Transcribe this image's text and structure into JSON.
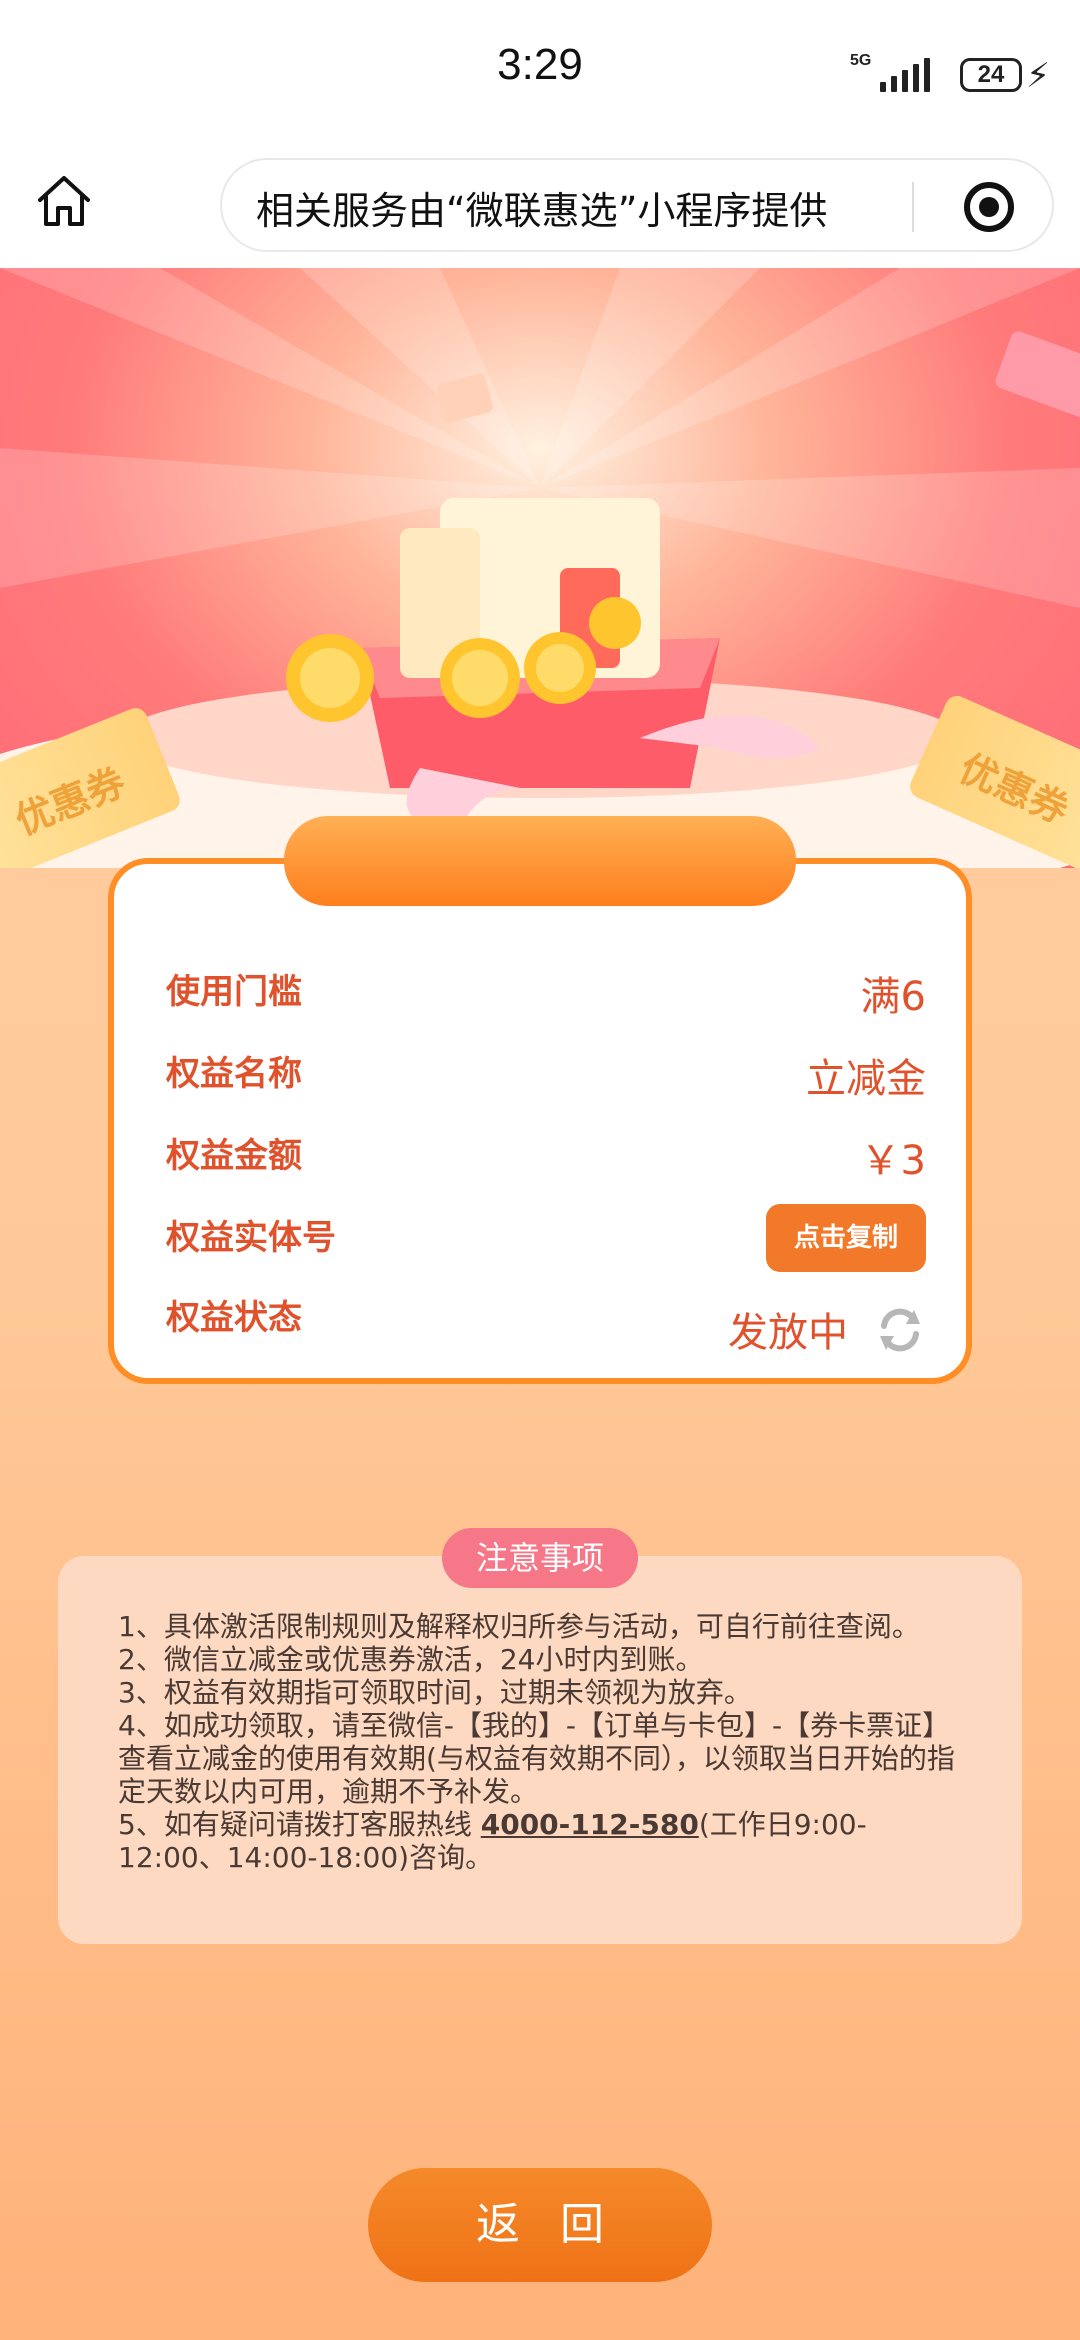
{
  "status_bar": {
    "time": "3:29",
    "network": "5G",
    "battery": "24"
  },
  "nav": {
    "service_text": "相关服务由“微联惠选”小程序提供"
  },
  "banner": {
    "left_ticket": "优惠券",
    "right_ticket": "优惠券"
  },
  "card": {
    "rows": [
      {
        "key": "使用门槛",
        "value": "满6"
      },
      {
        "key": "权益名称",
        "value": "立减金"
      },
      {
        "key": "权益金额",
        "value": "￥3"
      },
      {
        "key": "权益实体号",
        "button": "点击复制"
      },
      {
        "key": "权益状态",
        "value": "发放中"
      }
    ]
  },
  "notice": {
    "title": "注意事项",
    "items": [
      "1、具体激活限制规则及解释权归所参与活动，可自行前往查阅。",
      "2、微信立减金或优惠券激活，24小时内到账。",
      "3、权益有效期指可领取时间，过期未领视为放弃。",
      "4、如成功领取，请至微信-【我的】-【订单与卡包】-【券卡票证】查看立减金的使用有效期(与权益有效期不同），以领取当日开始的指定天数以内可用，逾期不予补发。"
    ],
    "item5_prefix": "5、如有疑问请拨打客服热线",
    "hotline": "4000-112-580",
    "item5_suffix": "(工作日9:00-12:00、14:00-18:00)咨询。"
  },
  "back_button": "返回"
}
